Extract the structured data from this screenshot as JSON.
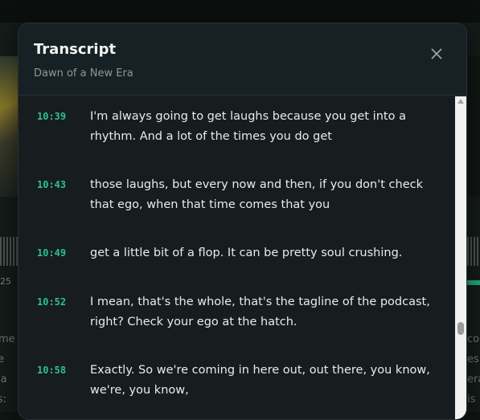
{
  "background": {
    "time_readout": "25",
    "left_text_lines": [
      "ome",
      "ke",
      " wa",
      "ss:"
    ],
    "right_text_lines": [
      "co",
      "es",
      "era",
      "is"
    ]
  },
  "modal": {
    "title": "Transcript",
    "subtitle": "Dawn of a New Era",
    "close_icon": "close-icon"
  },
  "transcript": [
    {
      "time": "10:39",
      "text": "I'm always going to get laughs because you get into a rhythm. And a lot of the times you do get"
    },
    {
      "time": "10:43",
      "text": "those laughs, but every now and then, if you don't check that ego, when that time comes that you"
    },
    {
      "time": "10:49",
      "text": "get a little bit of a flop. It can be pretty soul crushing."
    },
    {
      "time": "10:52",
      "text": "I mean, that's the whole, that's the tagline of the podcast, right? Check your ego at the hatch."
    },
    {
      "time": "10:58",
      "text": "Exactly. So we're coming in here out, out there, you know, we're, you know,"
    }
  ],
  "colors": {
    "accent": "#2bc08f",
    "modal_bg": "#171d1f",
    "text": "#e7ebea"
  }
}
